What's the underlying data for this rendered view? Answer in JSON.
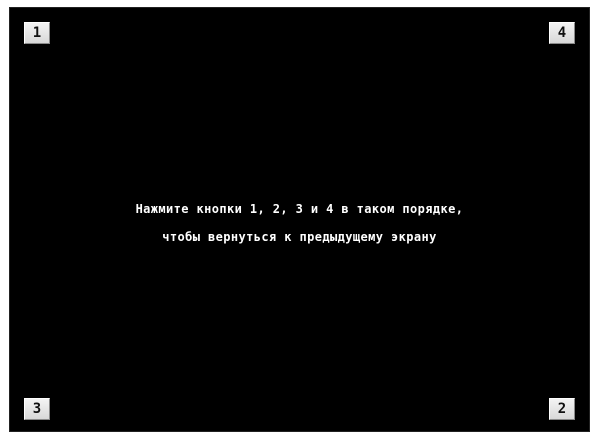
{
  "buttons": {
    "top_left": "1",
    "top_right": "4",
    "bottom_left": "3",
    "bottom_right": "2"
  },
  "message": {
    "line1": "Нажмите кнопки 1, 2, 3 и 4 в таком порядке,",
    "line2": "чтобы вернуться к предыдущему экрану"
  },
  "colors": {
    "background": "#000000",
    "text": "#ffffff",
    "button_face": "#e6e6e6"
  }
}
